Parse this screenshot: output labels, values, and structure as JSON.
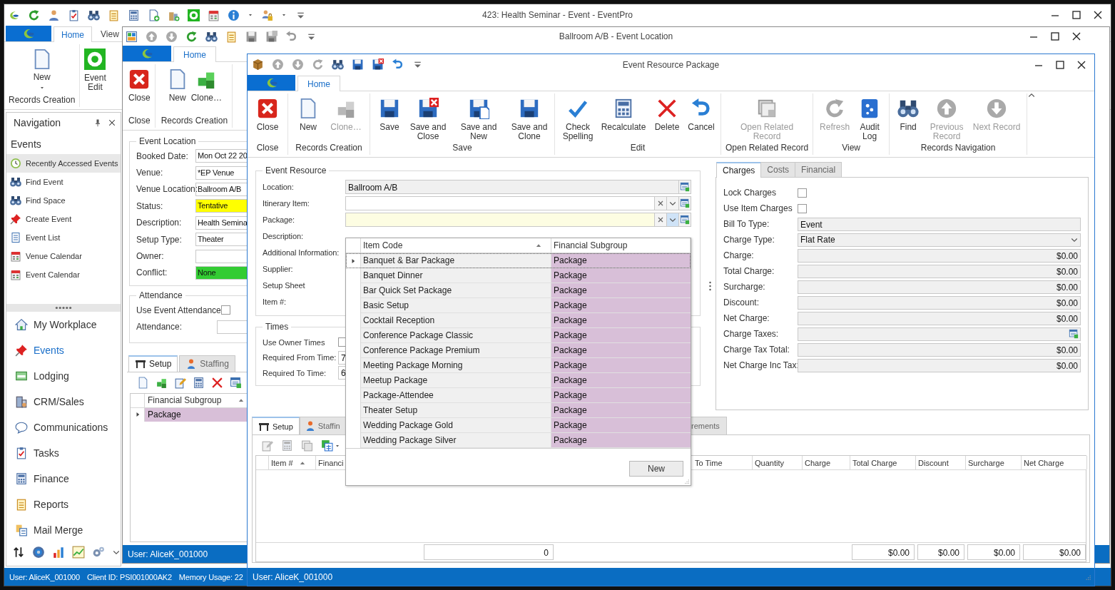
{
  "main_window": {
    "title": "423: Health Seminar - Event - EventPro",
    "ribbon_tabs": [
      {
        "label": "Home",
        "selected": true
      },
      {
        "label": "View",
        "selected": false
      }
    ],
    "ribbon_buttons": [
      {
        "label": "New",
        "dropdown": true
      },
      {
        "label": "Event Edit",
        "dropdown": false
      }
    ],
    "ribbon_group": "Records Creation",
    "navigation": {
      "title": "Navigation",
      "section": "Events",
      "items": [
        {
          "label": "Recently Accessed Events",
          "selected": true
        },
        {
          "label": "Find Event",
          "selected": false
        },
        {
          "label": "Find Space",
          "selected": false
        },
        {
          "label": "Create Event",
          "selected": false
        },
        {
          "label": "Event List",
          "selected": false
        },
        {
          "label": "Venue Calendar",
          "selected": false
        },
        {
          "label": "Event Calendar",
          "selected": false
        }
      ],
      "modules": [
        {
          "label": "My Workplace",
          "selected": false
        },
        {
          "label": "Events",
          "selected": true
        },
        {
          "label": "Lodging",
          "selected": false
        },
        {
          "label": "CRM/Sales",
          "selected": false
        },
        {
          "label": "Communications",
          "selected": false
        },
        {
          "label": "Tasks",
          "selected": false
        },
        {
          "label": "Finance",
          "selected": false
        },
        {
          "label": "Reports",
          "selected": false
        },
        {
          "label": "Mail Merge",
          "selected": false
        }
      ]
    },
    "status_bar": [
      "User: AliceK_001000",
      "Client ID: PSI001000AK2",
      "Memory Usage: 22"
    ]
  },
  "location_window": {
    "title": "Ballroom A/B - Event Location",
    "ribbon_tabs": [
      {
        "label": "Home",
        "selected": true
      }
    ],
    "ribbon_groups": [
      {
        "label": "Close",
        "buttons": [
          {
            "label": "Close"
          }
        ]
      },
      {
        "label": "Records Creation",
        "buttons": [
          {
            "label": "New"
          },
          {
            "label": "Clone…"
          }
        ]
      }
    ],
    "event_location": {
      "title": "Event Location",
      "fields": [
        {
          "label": "Booked Date:",
          "value": "Mon Oct 22 20"
        },
        {
          "label": "Venue:",
          "value": "*EP Venue"
        },
        {
          "label": "Venue Location:",
          "value": "Ballroom A/B"
        },
        {
          "label": "Status:",
          "value": "Tentative",
          "color": "#ffff00"
        },
        {
          "label": "Description:",
          "value": "Health Semina"
        },
        {
          "label": "Setup Type:",
          "value": "Theater"
        },
        {
          "label": "Owner:"
        },
        {
          "label": "Conflict:",
          "value": "None",
          "color": "#33cc33"
        }
      ]
    },
    "attendance": {
      "title": "Attendance",
      "use_event_attendance": {
        "label": "Use Event Attendance",
        "checked": false
      },
      "attendance_label": "Attendance:"
    },
    "tabs": [
      {
        "label": "Setup",
        "selected": true
      },
      {
        "label": "Staffing",
        "selected": false
      }
    ],
    "grid": {
      "columns": [
        {
          "label": "Financial Subgroup",
          "sorted": true
        }
      ],
      "rows": [
        {
          "cells": [
            "Package"
          ],
          "selected": true
        }
      ]
    },
    "status_bar": "User: AliceK_001000"
  },
  "resource_window": {
    "title": "Event Resource Package",
    "ribbon_tabs": [
      {
        "label": "Home",
        "selected": true
      }
    ],
    "ribbon_groups": [
      {
        "label": "Close",
        "buttons": [
          {
            "label": "Close",
            "disabled": false
          }
        ]
      },
      {
        "label": "Records Creation",
        "buttons": [
          {
            "label": "New",
            "disabled": false
          },
          {
            "label": "Clone…",
            "disabled": true
          }
        ]
      },
      {
        "label": "Save",
        "buttons": [
          {
            "label": "Save",
            "disabled": false
          },
          {
            "label": "Save and Close",
            "disabled": false
          },
          {
            "label": "Save and New",
            "disabled": false
          },
          {
            "label": "Save and Clone",
            "disabled": false
          }
        ]
      },
      {
        "label": "Edit",
        "buttons": [
          {
            "label": "Check Spelling",
            "disabled": false
          },
          {
            "label": "Recalculate",
            "disabled": false
          },
          {
            "label": "Delete",
            "disabled": false
          },
          {
            "label": "Cancel",
            "disabled": false
          }
        ]
      },
      {
        "label": "Open Related Record",
        "buttons": [
          {
            "label": "Open Related Record",
            "disabled": true
          }
        ]
      },
      {
        "label": "View",
        "buttons": [
          {
            "label": "Refresh",
            "disabled": true
          },
          {
            "label": "Audit Log",
            "disabled": false
          }
        ]
      },
      {
        "label": "Records Navigation",
        "buttons": [
          {
            "label": "Find",
            "disabled": false
          },
          {
            "label": "Previous Record",
            "disabled": true
          },
          {
            "label": "Next Record",
            "disabled": true
          }
        ]
      }
    ],
    "event_resource": {
      "title": "Event Resource",
      "fields": [
        {
          "label": "Location:",
          "kind": "lookup",
          "value": "Ballroom A/B"
        },
        {
          "label": "Itinerary Item:",
          "kind": "combo",
          "open": false
        },
        {
          "label": "Package:",
          "kind": "combo",
          "open": true
        },
        {
          "label": "Description:",
          "kind": "covered"
        },
        {
          "label": "Additional Information:",
          "kind": "covered"
        },
        {
          "label": "Supplier:",
          "kind": "covered"
        },
        {
          "label": "Setup Sheet",
          "kind": "covered"
        },
        {
          "label": "Item #:",
          "kind": "covered"
        }
      ]
    },
    "times": {
      "title": "Times",
      "use_owner_times": {
        "label": "Use Owner Times",
        "checked": false
      },
      "fields": [
        {
          "label": "Required From Time:",
          "value": "7"
        },
        {
          "label": "Required To Time:",
          "value": "6"
        }
      ]
    },
    "package_dropdown": {
      "columns": [
        {
          "label": "Item Code",
          "sorted": true
        },
        {
          "label": "Financial Subgroup",
          "sorted": false
        }
      ],
      "rows": [
        {
          "item_code": "Banquet & Bar Package",
          "financial_subgroup": "Package",
          "selected": true
        },
        {
          "item_code": "Banquet Dinner",
          "financial_subgroup": "Package",
          "selected": false
        },
        {
          "item_code": "Bar Quick Set Package",
          "financial_subgroup": "Package",
          "selected": false
        },
        {
          "item_code": "Basic Setup",
          "financial_subgroup": "Package",
          "selected": false
        },
        {
          "item_code": "Cocktail Reception",
          "financial_subgroup": "Package",
          "selected": false
        },
        {
          "item_code": "Conference Package Classic",
          "financial_subgroup": "Package",
          "selected": false
        },
        {
          "item_code": "Conference Package Premium",
          "financial_subgroup": "Package",
          "selected": false
        },
        {
          "item_code": "Meeting Package Morning",
          "financial_subgroup": "Package",
          "selected": false
        },
        {
          "item_code": "Meetup Package",
          "financial_subgroup": "Package",
          "selected": false
        },
        {
          "item_code": "Package-Attendee",
          "financial_subgroup": "Package",
          "selected": false
        },
        {
          "item_code": "Theater Setup",
          "financial_subgroup": "Package",
          "selected": false
        },
        {
          "item_code": "Wedding Package Gold",
          "financial_subgroup": "Package",
          "selected": false
        },
        {
          "item_code": "Wedding Package Silver",
          "financial_subgroup": "Package",
          "selected": false
        }
      ],
      "button": "New"
    },
    "charges_panel": {
      "tabs": [
        {
          "label": "Charges",
          "selected": true
        },
        {
          "label": "Costs",
          "selected": false
        },
        {
          "label": "Financial",
          "selected": false
        }
      ],
      "checkboxes": [
        {
          "label": "Lock Charges",
          "checked": false
        },
        {
          "label": "Use Item Charges",
          "checked": false
        }
      ],
      "fields": [
        {
          "label": "Bill To Type:",
          "kind": "text",
          "value": "Event"
        },
        {
          "label": "Charge Type:",
          "kind": "dropdown",
          "value": "Flat Rate"
        },
        {
          "label": "Charge:",
          "kind": "amount",
          "value": "$0.00"
        },
        {
          "label": "Total Charge:",
          "kind": "amount",
          "value": "$0.00"
        },
        {
          "label": "Surcharge:",
          "kind": "amount",
          "value": "$0.00"
        },
        {
          "label": "Discount:",
          "kind": "amount",
          "value": "$0.00"
        },
        {
          "label": "Net Charge:",
          "kind": "amount",
          "value": "$0.00"
        },
        {
          "label": "Charge Taxes:",
          "kind": "lookup"
        },
        {
          "label": "Charge Tax Total:",
          "kind": "amount",
          "value": "$0.00"
        },
        {
          "label": "Net Charge Inc Tax:",
          "kind": "amount",
          "value": "$0.00"
        }
      ]
    },
    "detail_tabs": [
      {
        "label": "Setup",
        "selected": true
      },
      {
        "label": "Staffin",
        "selected": false
      },
      {
        "label": "rements",
        "selected": false
      }
    ],
    "detail_grid": {
      "columns": [
        {
          "label": "Item #",
          "sorted": true
        },
        {
          "label": "Financi"
        },
        {
          "label": "To Time",
          "sorted": false
        },
        {
          "label": "Quantity",
          "sorted": false
        },
        {
          "label": "Charge",
          "sorted": false
        },
        {
          "label": "Total Charge",
          "sorted": false
        },
        {
          "label": "Discount",
          "sorted": false
        },
        {
          "label": "Surcharge",
          "sorted": false
        },
        {
          "label": "Net Charge",
          "sorted": false
        }
      ],
      "totals": [
        "0",
        "$0.00",
        "$0.00",
        "$0.00",
        "$0.00"
      ]
    },
    "status_bar": "User: AliceK_001000"
  }
}
